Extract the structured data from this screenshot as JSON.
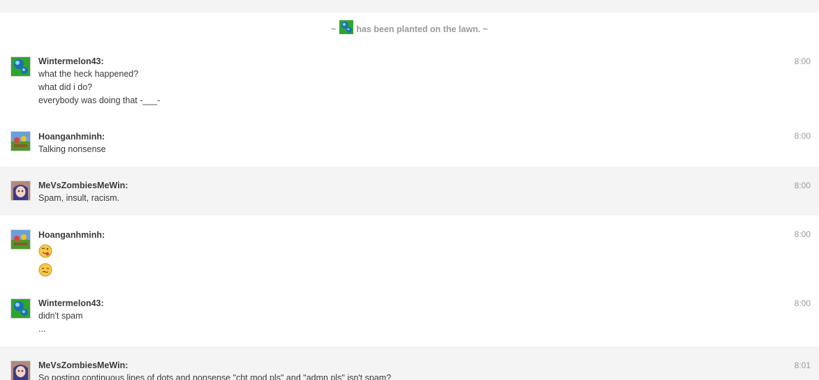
{
  "inline_message": {
    "prefix": "~",
    "text": "has been planted on the lawn. ~",
    "avatar_icon": "wintermelon-icon"
  },
  "messages": [
    {
      "user": "Wintermelon43:",
      "time": "8:00",
      "avatar": "wintermelon-avatar",
      "lines": [
        "what the heck happened?",
        "what did i do?",
        "everybody was doing that -___-"
      ]
    },
    {
      "user": "Hoanganhminh:",
      "time": "8:00",
      "avatar": "garden-avatar",
      "lines": [
        "Talking nonsense"
      ]
    },
    {
      "user": "MeVsZombiesMeWin:",
      "time": "8:00",
      "avatar": "anime-girl-avatar",
      "lines": [
        "Spam, insult, racism."
      ]
    },
    {
      "user": "Hoanganhminh:",
      "time": "8:00",
      "avatar": "garden-avatar",
      "emojis": [
        "tongue-emoji",
        "confused-emoji"
      ]
    },
    {
      "user": "Wintermelon43:",
      "time": "8:00",
      "avatar": "wintermelon-avatar",
      "lines": [
        "didn't spam",
        "..."
      ]
    },
    {
      "user": "MeVsZombiesMeWin:",
      "time": "8:01",
      "avatar": "anime-girl-avatar",
      "lines": [
        "So posting continuous lines of dots and nonsense \"cht mod pls\" and \"admn pls\" isn't spam?"
      ]
    }
  ],
  "colors": {
    "alt_row_bg": "#f4f4f4",
    "text": "#3a3a3a",
    "muted": "#9a9a9a"
  }
}
